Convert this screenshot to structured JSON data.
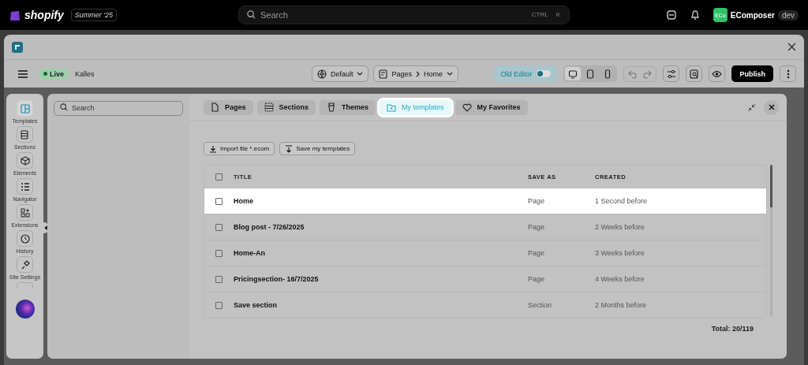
{
  "topbar": {
    "brand": "shopify",
    "edition": "Summer '25",
    "search": {
      "placeholder": "Search"
    },
    "shortcut": [
      "CTRL",
      "K"
    ],
    "account": {
      "initials": "ECo",
      "name": "EComposer",
      "tag": "dev"
    }
  },
  "toolbar": {
    "status": "Live",
    "store": "Kalles",
    "theme": "Default",
    "breadcrumb": [
      "Pages",
      "Home"
    ],
    "old_editor": {
      "label": "Old Editor",
      "on": false
    },
    "devices": [
      {
        "kind": "desktop",
        "selected": true
      },
      {
        "kind": "tablet",
        "selected": false
      },
      {
        "kind": "mobile",
        "selected": false
      }
    ],
    "publish": "Publish"
  },
  "sidebar": {
    "items": [
      {
        "label": "Templates",
        "kind": "templates",
        "selected": true
      },
      {
        "label": "Sections",
        "kind": "sections",
        "selected": false
      },
      {
        "label": "Elements",
        "kind": "elements",
        "selected": false
      },
      {
        "label": "Navigator",
        "kind": "navigator",
        "selected": false
      },
      {
        "label": "Extensions",
        "kind": "extensions",
        "selected": false
      },
      {
        "label": "History",
        "kind": "history",
        "selected": false
      },
      {
        "label": "Site Settings",
        "kind": "settings",
        "selected": false
      }
    ]
  },
  "library": {
    "search": {
      "placeholder": "Search"
    },
    "tabs": [
      {
        "label": "Pages",
        "kind": "pages",
        "selected": false
      },
      {
        "label": "Sections",
        "kind": "sections",
        "selected": false
      },
      {
        "label": "Themes",
        "kind": "themes",
        "selected": false
      },
      {
        "label": "My templates",
        "kind": "templates",
        "selected": true
      },
      {
        "label": "My Favorites",
        "kind": "favorites",
        "selected": false
      }
    ],
    "actions": [
      {
        "label": "Import file *.ecom",
        "kind": "import"
      },
      {
        "label": "Save my templates",
        "kind": "save"
      }
    ],
    "table": {
      "select_all": {
        "checked": false
      },
      "columns": [
        "TITLE",
        "SAVE AS",
        "CREATED"
      ],
      "rows": [
        {
          "title": "Home",
          "save_as": "Page",
          "created": "1 Second before",
          "selected": true,
          "checked": false
        },
        {
          "title": "Blog post - 7/26/2025",
          "save_as": "Page",
          "created": "2 Weeks before",
          "selected": false,
          "checked": false
        },
        {
          "title": "Home-An",
          "save_as": "Page",
          "created": "3 Weeks before",
          "selected": false,
          "checked": false
        },
        {
          "title": "Pricingsection- 16/7/2025",
          "save_as": "Page",
          "created": "4 Weeks before",
          "selected": false,
          "checked": false
        },
        {
          "title": "Save section",
          "save_as": "Section",
          "created": "2 Months before",
          "selected": false,
          "checked": false
        }
      ]
    },
    "total": "Total: 20/119"
  }
}
